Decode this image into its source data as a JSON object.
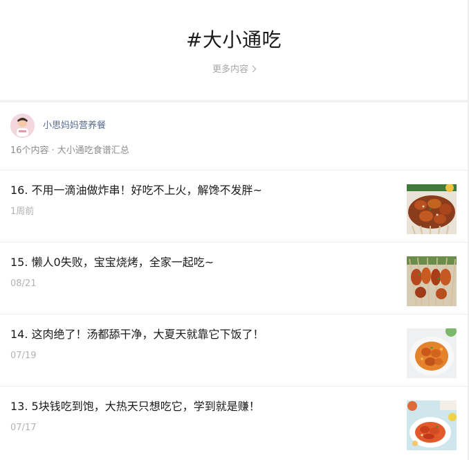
{
  "header": {
    "title": "#大小通吃",
    "more_label": "更多内容"
  },
  "author": {
    "name": "小思妈妈营养餐",
    "count": "16个内容",
    "separator": "·",
    "collection": "大小通吃食谱汇总"
  },
  "articles": [
    {
      "title": "16. 不用一滴油做炸串！好吃不上火，解馋不发胖~",
      "date": "1周前",
      "thumb": "grilled-skewers-on-plate"
    },
    {
      "title": "15. 懒人0失败，宝宝烧烤，全家一起吃~",
      "date": "08/21",
      "thumb": "bbq-skewers-on-tray"
    },
    {
      "title": "14. 这肉绝了！汤都舔干净，大夏天就靠它下饭了！",
      "date": "07/19",
      "thumb": "braised-meat-in-sauce"
    },
    {
      "title": "13. 5块钱吃到饱，大热天只想吃它，学到就是赚！",
      "date": "07/17",
      "thumb": "fried-dish-on-plate"
    }
  ],
  "colors": {
    "link_blue": "#576b95",
    "muted_gray": "#8c8c8c",
    "date_gray": "#b2b2b2",
    "divider": "#ededed"
  },
  "icons": {
    "more_chevron": "chevron-right-icon"
  }
}
